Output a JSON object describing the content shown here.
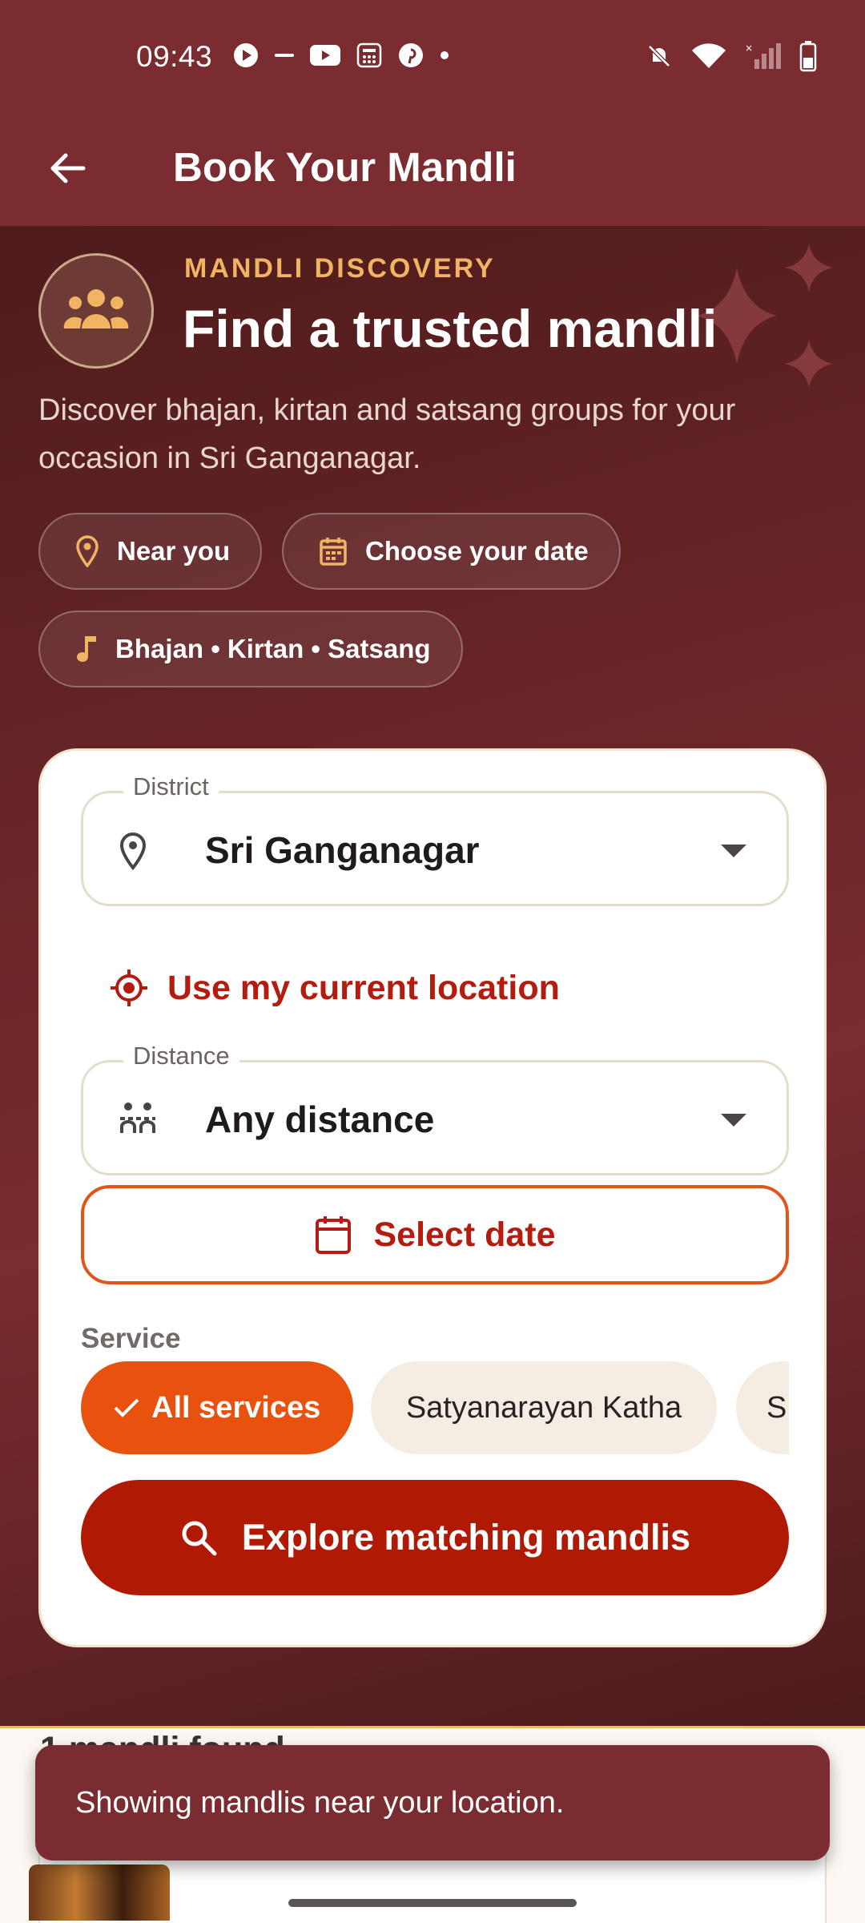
{
  "status_bar": {
    "time": "09:43"
  },
  "app_bar": {
    "title": "Book Your Mandli",
    "back_icon": "arrow-left-icon"
  },
  "hero": {
    "eyebrow": "MANDLI DISCOVERY",
    "title": "Find a trusted mandli",
    "description": "Discover bhajan, kirtan and satsang groups for your occasion in Sri Ganganagar.",
    "pills": [
      {
        "icon": "location-pin-icon",
        "label": "Near you"
      },
      {
        "icon": "calendar-icon",
        "label": "Choose your date"
      },
      {
        "icon": "music-note-icon",
        "label": "Bhajan • Kirtan • Satsang"
      }
    ]
  },
  "form": {
    "district": {
      "label": "District",
      "value": "Sri Ganganagar"
    },
    "use_location_label": "Use my current location",
    "distance": {
      "label": "Distance",
      "value": "Any distance"
    },
    "date_button_label": "Select date",
    "service_label": "Service",
    "services": [
      {
        "label": "All services",
        "selected": true
      },
      {
        "label": "Satyanarayan Katha",
        "selected": false
      },
      {
        "label": "S",
        "selected": false
      }
    ],
    "explore_button_label": "Explore matching mandlis"
  },
  "results": {
    "count_text": "1 mandli found"
  },
  "snackbar": {
    "message": "Showing mandlis near your location."
  },
  "colors": {
    "brand": "#7a2c30",
    "accent": "#e8510e",
    "primary_button": "#b01a04",
    "eyebrow": "#f0b463"
  }
}
